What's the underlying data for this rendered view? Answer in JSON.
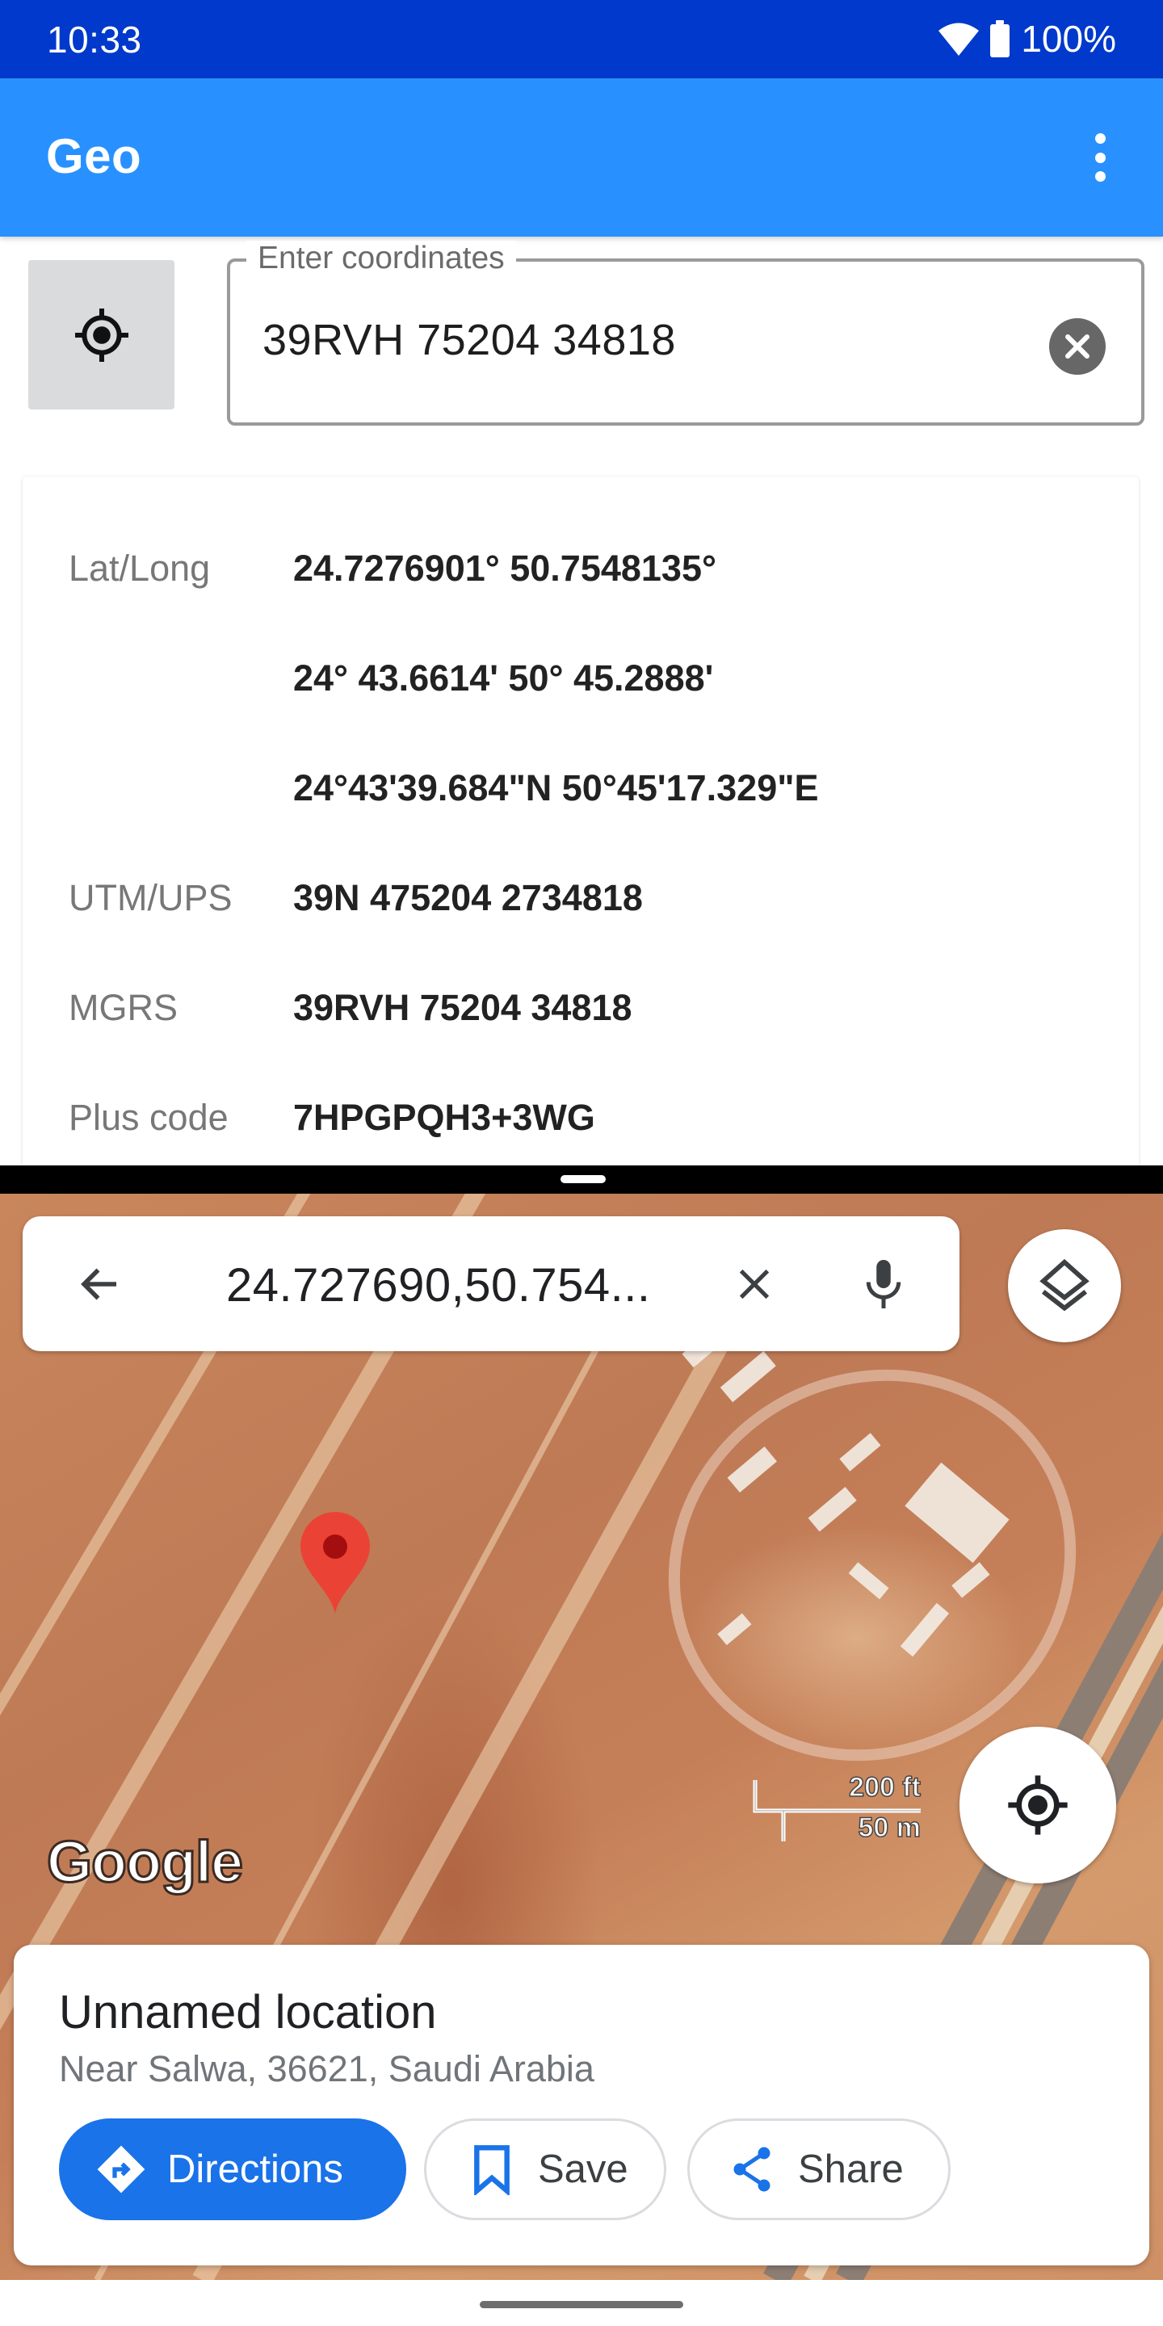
{
  "status_bar": {
    "time": "10:33",
    "battery": "100%",
    "icons": [
      "wifi-icon",
      "battery-icon"
    ]
  },
  "app_bar": {
    "title": "Geo",
    "menu_icon": "more-vert-icon"
  },
  "coordinate_input": {
    "locate_icon": "my-location-icon",
    "label": "Enter coordinates",
    "value": "39RVH 75204 34818",
    "clear_icon": "clear-circle-icon"
  },
  "results": [
    {
      "label": "Lat/Long",
      "value": "24.7276901° 50.7548135°"
    },
    {
      "label": "",
      "value": "24° 43.6614' 50° 45.2888'"
    },
    {
      "label": "",
      "value": "24°43'39.684\"N 50°45'17.329\"E"
    },
    {
      "label": "UTM/UPS",
      "value": "39N 475204 2734818"
    },
    {
      "label": "MGRS",
      "value": "39RVH 75204 34818"
    },
    {
      "label": "Plus code",
      "value": "7HPGPQH3+3WG"
    }
  ],
  "colors": {
    "status_bar": "#0039CB",
    "app_bar": "#2891FF",
    "accent_blue": "#1A73E8",
    "marker_red": "#EA4335"
  },
  "map": {
    "search_text": "24.727690,50.754...",
    "back_icon": "arrow-back-icon",
    "clear_icon": "close-icon",
    "mic_icon": "mic-icon",
    "layers_icon": "layers-icon",
    "my_location_icon": "my-location-icon",
    "scale_imperial": "200 ft",
    "scale_metric": "50 m",
    "logo": "Google",
    "marker_icon": "map-pin-icon"
  },
  "place_card": {
    "title": "Unnamed location",
    "subtitle": "Near Salwa, 36621, Saudi Arabia",
    "buttons": [
      {
        "label": "Directions",
        "icon": "directions-icon"
      },
      {
        "label": "Save",
        "icon": "bookmark-icon"
      },
      {
        "label": "Share",
        "icon": "share-icon"
      }
    ]
  }
}
